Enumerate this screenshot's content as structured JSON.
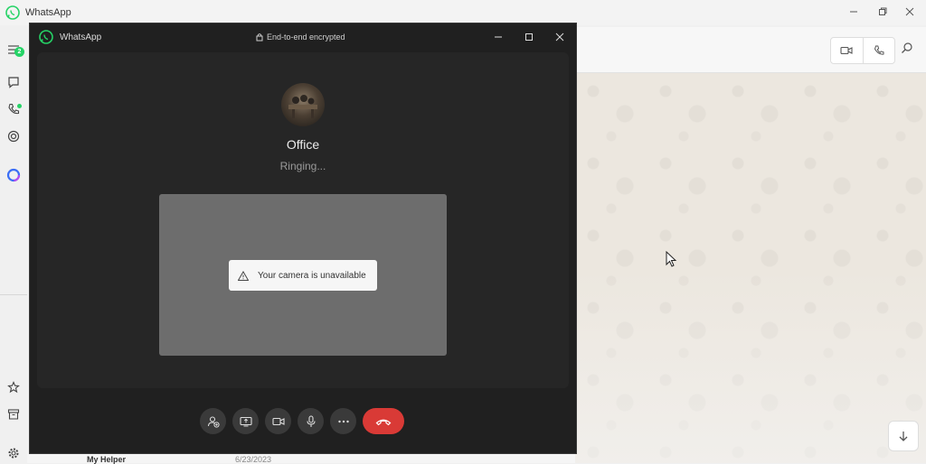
{
  "app": {
    "title": "WhatsApp",
    "badge_count": "2"
  },
  "call": {
    "window_title": "WhatsApp",
    "encryption_label": "End-to-end encrypted",
    "contact_name": "Office",
    "status": "Ringing...",
    "camera_message": "Your camera is unavailable"
  },
  "chat_list_peek": {
    "name": "My Helper",
    "date": "6/23/2023"
  },
  "icons": {
    "left_rail": [
      "menu-icon",
      "chats-icon",
      "calls-icon",
      "status-icon",
      "meta-ai-icon",
      "starred-icon",
      "archive-icon",
      "settings-icon"
    ],
    "header": [
      "video-call-icon",
      "voice-call-icon",
      "search-icon"
    ],
    "call_controls": [
      "add-participant-icon",
      "share-screen-icon",
      "camera-icon",
      "microphone-icon",
      "more-icon",
      "end-call-icon"
    ]
  },
  "colors": {
    "brand": "#25d366",
    "end_call": "#d93a36",
    "call_bg": "#202020"
  }
}
